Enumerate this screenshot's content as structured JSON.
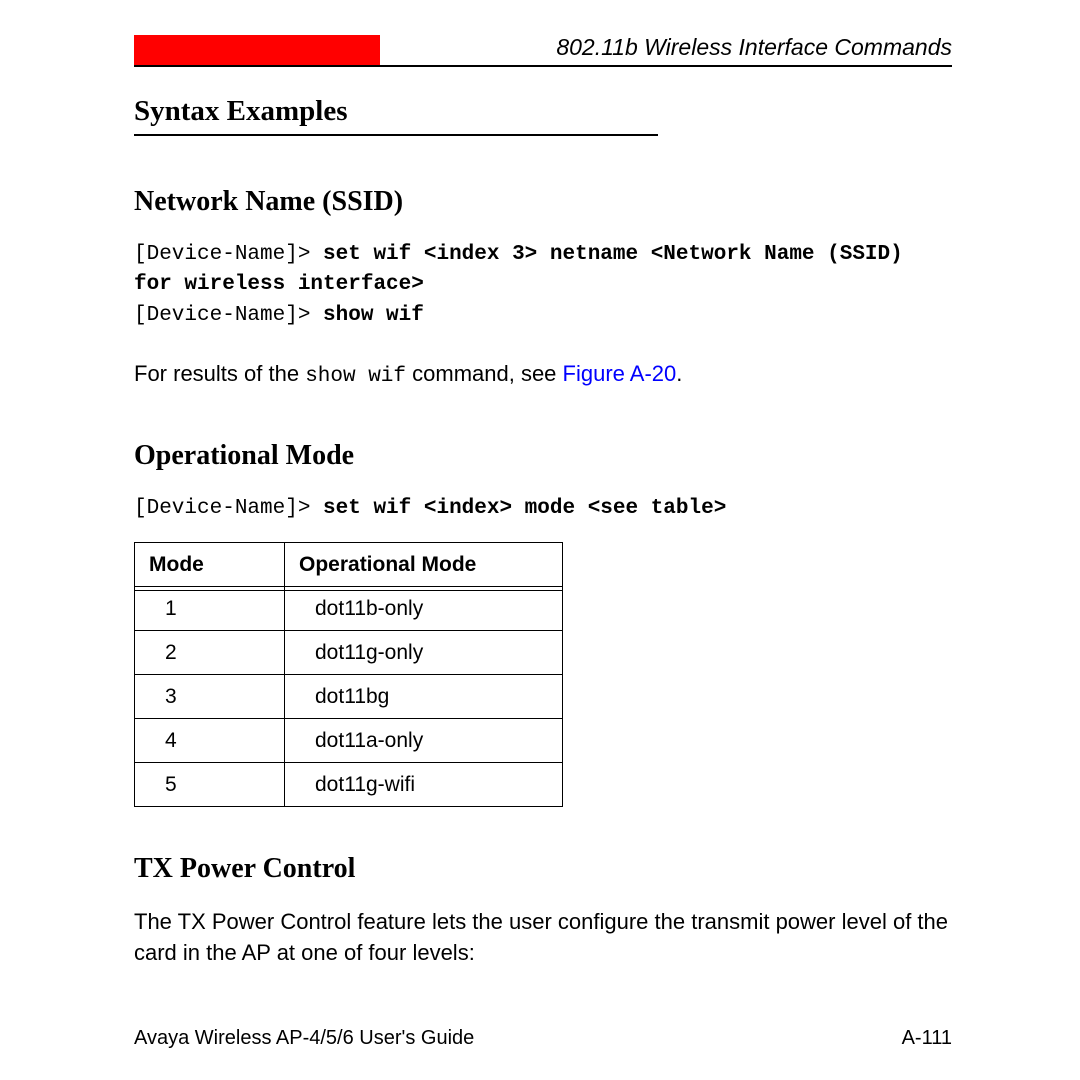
{
  "header": {
    "chapter_title": "802.11b Wireless Interface Commands"
  },
  "sections": {
    "syntax_examples": "Syntax Examples",
    "network_name": {
      "heading": "Network Name (SSID)",
      "cmd_prompt1": "[Device-Name]>",
      "cmd_bold1a": "set wif <index 3> netname <Network Name (SSID)",
      "cmd_bold1b": "for wireless interface>",
      "cmd_prompt2": "[Device-Name]>",
      "cmd_bold2": "show wif",
      "result_prefix": "For results of the ",
      "result_mono": "show wif",
      "result_mid": " command, see ",
      "result_link": "Figure A-20",
      "result_suffix": "."
    },
    "operational_mode": {
      "heading": "Operational Mode",
      "cmd_prompt": "[Device-Name]>",
      "cmd_bold": "set wif <index> mode <see table>",
      "table": {
        "headers": [
          "Mode",
          "Operational Mode"
        ],
        "rows": [
          [
            "1",
            "dot11b-only"
          ],
          [
            "2",
            "dot11g-only"
          ],
          [
            "3",
            "dot11bg"
          ],
          [
            "4",
            "dot11a-only"
          ],
          [
            "5",
            "dot11g-wifi"
          ]
        ]
      }
    },
    "tx_power": {
      "heading": "TX Power Control",
      "body": "The TX Power Control feature lets the user configure the transmit power level of the card in the AP at one of four levels:"
    }
  },
  "footer": {
    "left": "Avaya Wireless AP-4/5/6 User's Guide",
    "right": "A-111"
  }
}
